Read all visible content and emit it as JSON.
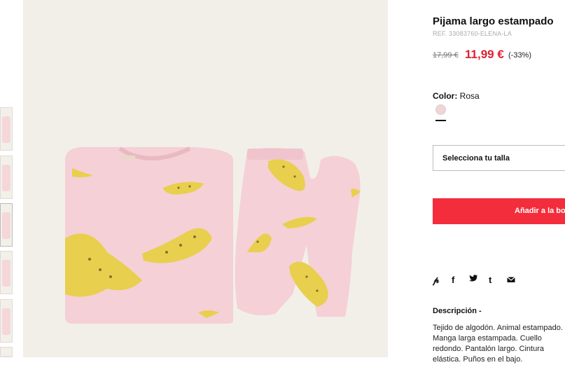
{
  "product": {
    "title": "Pijama largo estampado",
    "ref": "REF. 33083760-ELENA-LA",
    "old_price": "17,99 €",
    "new_price": "11,99 €",
    "discount": "(-33%)"
  },
  "color": {
    "label": "Color:",
    "value": "Rosa",
    "swatch_color": "#efd6d6"
  },
  "size_select": {
    "placeholder": "Selecciona tu talla"
  },
  "add_button": {
    "label": "Añadir a la bolsa"
  },
  "share": {
    "icons": [
      "pinterest-icon",
      "facebook-icon",
      "twitter-icon",
      "tumblr-icon",
      "email-icon"
    ],
    "glyphs": [
      "℗",
      "f",
      "🐦",
      "t",
      "✉"
    ]
  },
  "description": {
    "heading": "Descripción -",
    "text": "Tejido de algodón. Animal estampado. Manga larga estampada. Cuello redondo. Pantalón largo. Cintura elástica. Puños en el bajo."
  },
  "colors": {
    "accent": "#f32d3c",
    "sale_price": "#e0202f",
    "pajama_pink": "#f5d0d6",
    "leopard_yellow": "#e8cf4e",
    "photo_bg": "#f2efe8"
  }
}
